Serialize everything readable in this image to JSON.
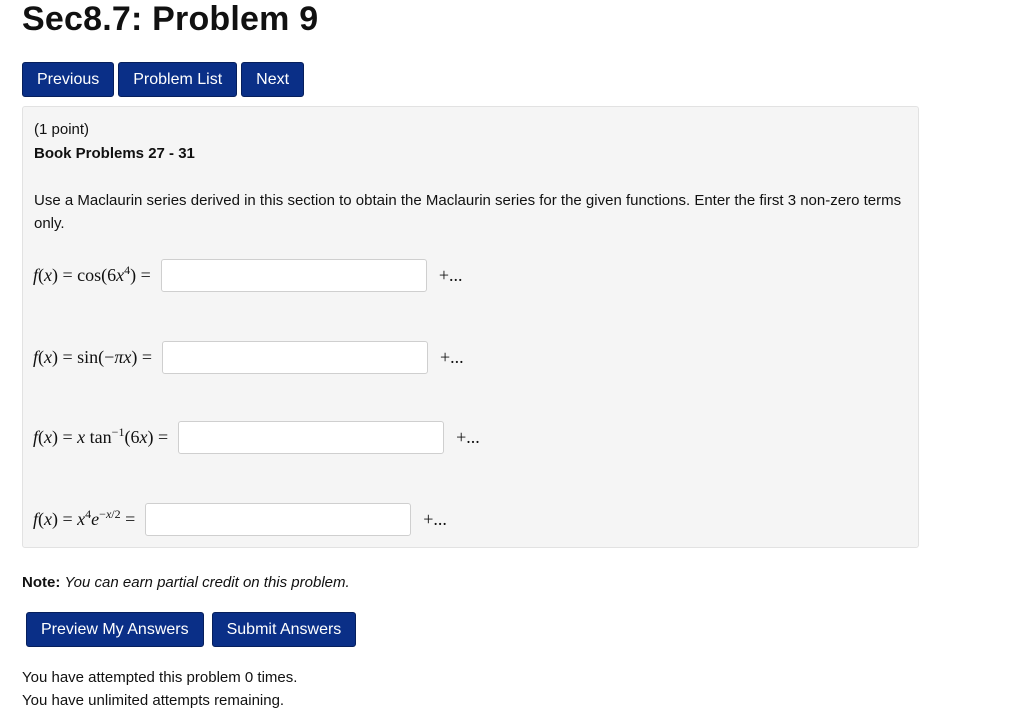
{
  "page": {
    "title": "Sec8.7: Problem 9"
  },
  "nav": {
    "previous": "Previous",
    "problem_list": "Problem List",
    "next": "Next"
  },
  "problem": {
    "points": "(1 point)",
    "book": "Book Problems 27 - 31",
    "instructions": "Use a Maclaurin series derived in this section to obtain the Maclaurin series for the given functions. Enter the first 3 non-zero terms only.",
    "continuation": "+...",
    "answers": [
      {
        "value": ""
      },
      {
        "value": ""
      },
      {
        "value": ""
      },
      {
        "value": ""
      }
    ]
  },
  "note": {
    "label": "Note:",
    "text": "You can earn partial credit on this problem."
  },
  "actions": {
    "preview": "Preview My Answers",
    "submit": "Submit Answers"
  },
  "status": {
    "attempted": "You have attempted this problem 0 times.",
    "remaining": "You have unlimited attempts remaining."
  }
}
